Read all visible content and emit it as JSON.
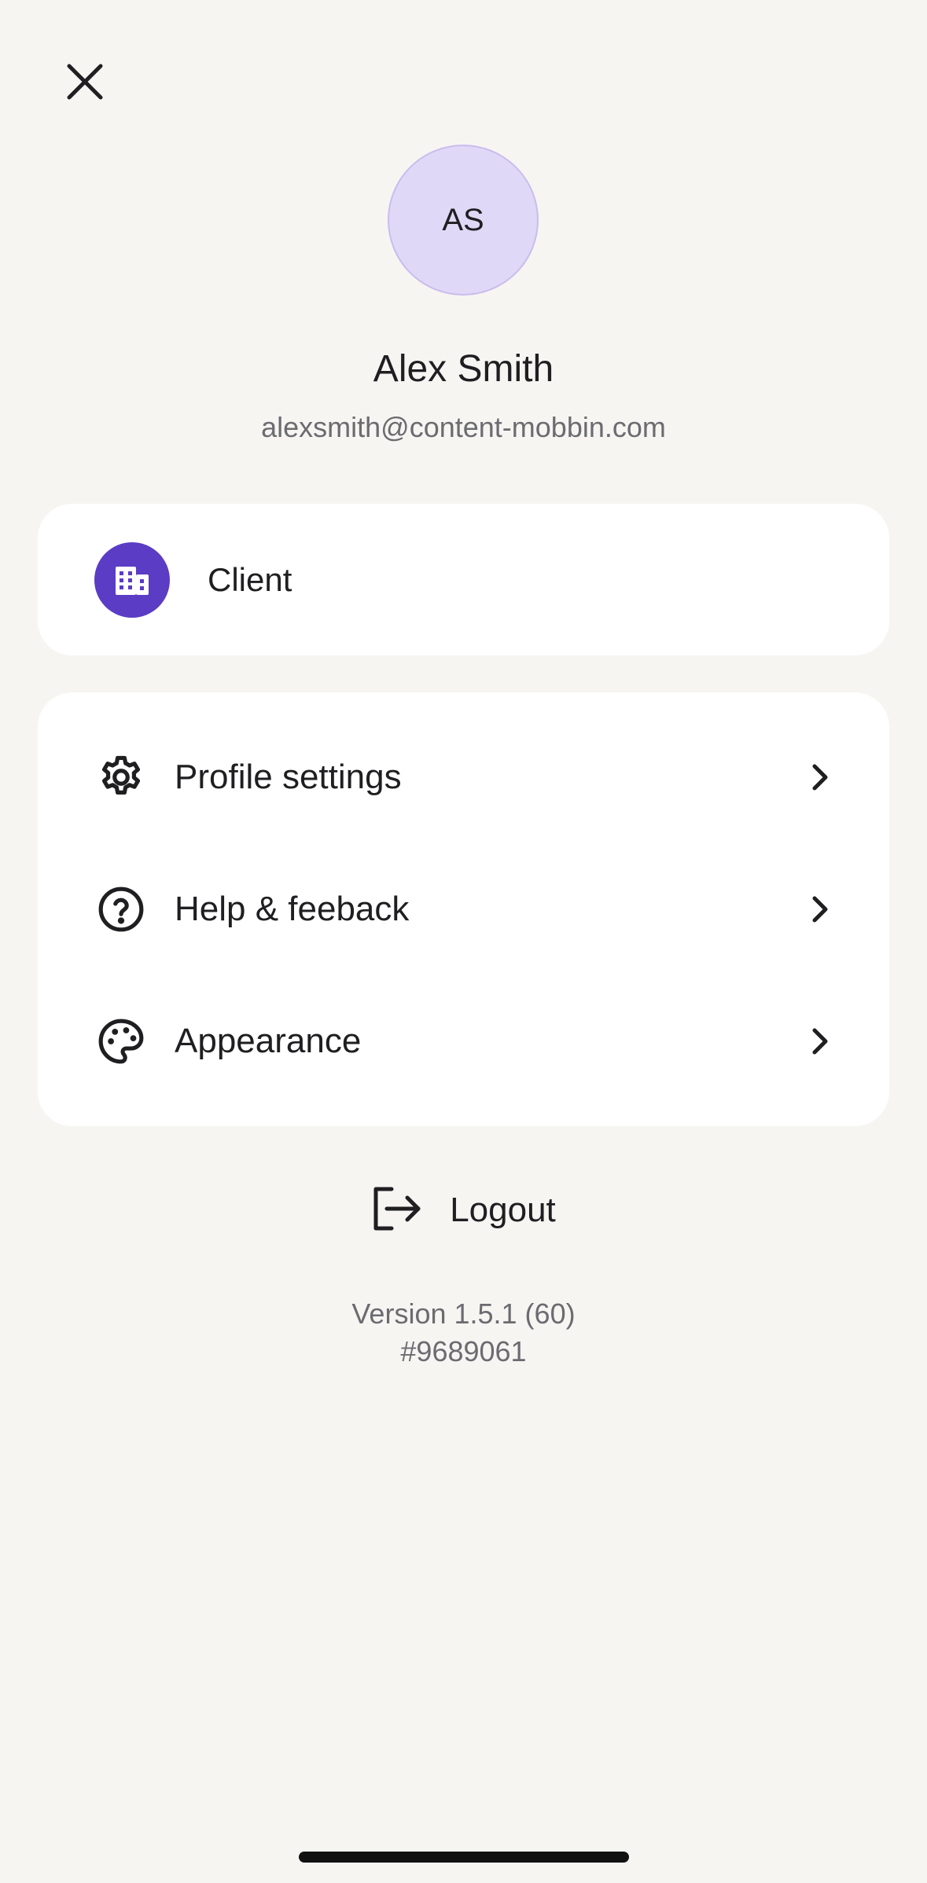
{
  "header": {
    "close_icon": "close-icon"
  },
  "profile": {
    "initials": "AS",
    "name": "Alex Smith",
    "email": "alexsmith@content-mobbin.com",
    "avatar_color": "#e0d8f7"
  },
  "account": {
    "label": "Client",
    "icon": "building-icon",
    "icon_color": "#5b3cc4"
  },
  "menu": {
    "items": [
      {
        "label": "Profile settings",
        "icon": "gear-icon"
      },
      {
        "label": "Help & feeback",
        "icon": "question-circle-icon"
      },
      {
        "label": "Appearance",
        "icon": "palette-icon"
      }
    ]
  },
  "logout": {
    "label": "Logout",
    "icon": "logout-icon"
  },
  "footer": {
    "version": "Version 1.5.1 (60)",
    "build": "#9689061"
  }
}
